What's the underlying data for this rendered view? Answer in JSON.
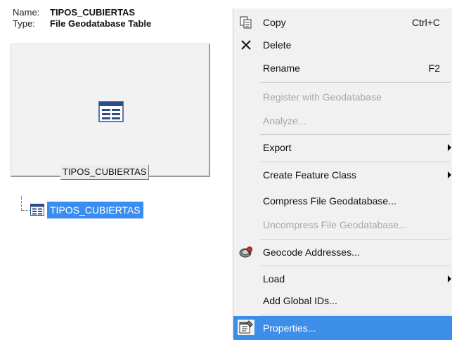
{
  "item_info": {
    "name_key": "Name:",
    "name_value": "TIPOS_CUBIERTAS",
    "type_key": "Type:",
    "type_value": "File Geodatabase Table"
  },
  "preview": {
    "label": "TIPOS_CUBIERTAS"
  },
  "tree": {
    "selected_item": "TIPOS_CUBIERTAS"
  },
  "context_menu": {
    "copy": {
      "label": "Copy",
      "shortcut": "Ctrl+C",
      "icon": "copy-icon"
    },
    "delete": {
      "label": "Delete",
      "icon": "delete-x-icon"
    },
    "rename": {
      "label": "Rename",
      "shortcut": "F2"
    },
    "register": {
      "label": "Register with Geodatabase",
      "enabled": false
    },
    "analyze": {
      "label": "Analyze...",
      "enabled": false
    },
    "export": {
      "label": "Export",
      "submenu": true
    },
    "create_feature_class": {
      "label": "Create Feature Class",
      "submenu": true
    },
    "compress": {
      "label": "Compress File Geodatabase..."
    },
    "uncompress": {
      "label": "Uncompress File Geodatabase...",
      "enabled": false
    },
    "geocode": {
      "label": "Geocode Addresses...",
      "icon": "geocode-icon"
    },
    "load": {
      "label": "Load",
      "submenu": true
    },
    "add_global_ids": {
      "label": "Add Global IDs..."
    },
    "properties": {
      "label": "Properties...",
      "icon": "properties-icon",
      "highlighted": true
    }
  },
  "colors": {
    "selection": "#3b8ef0",
    "menu_background": "#f1f1f1",
    "disabled_text": "#a7a7a7"
  }
}
